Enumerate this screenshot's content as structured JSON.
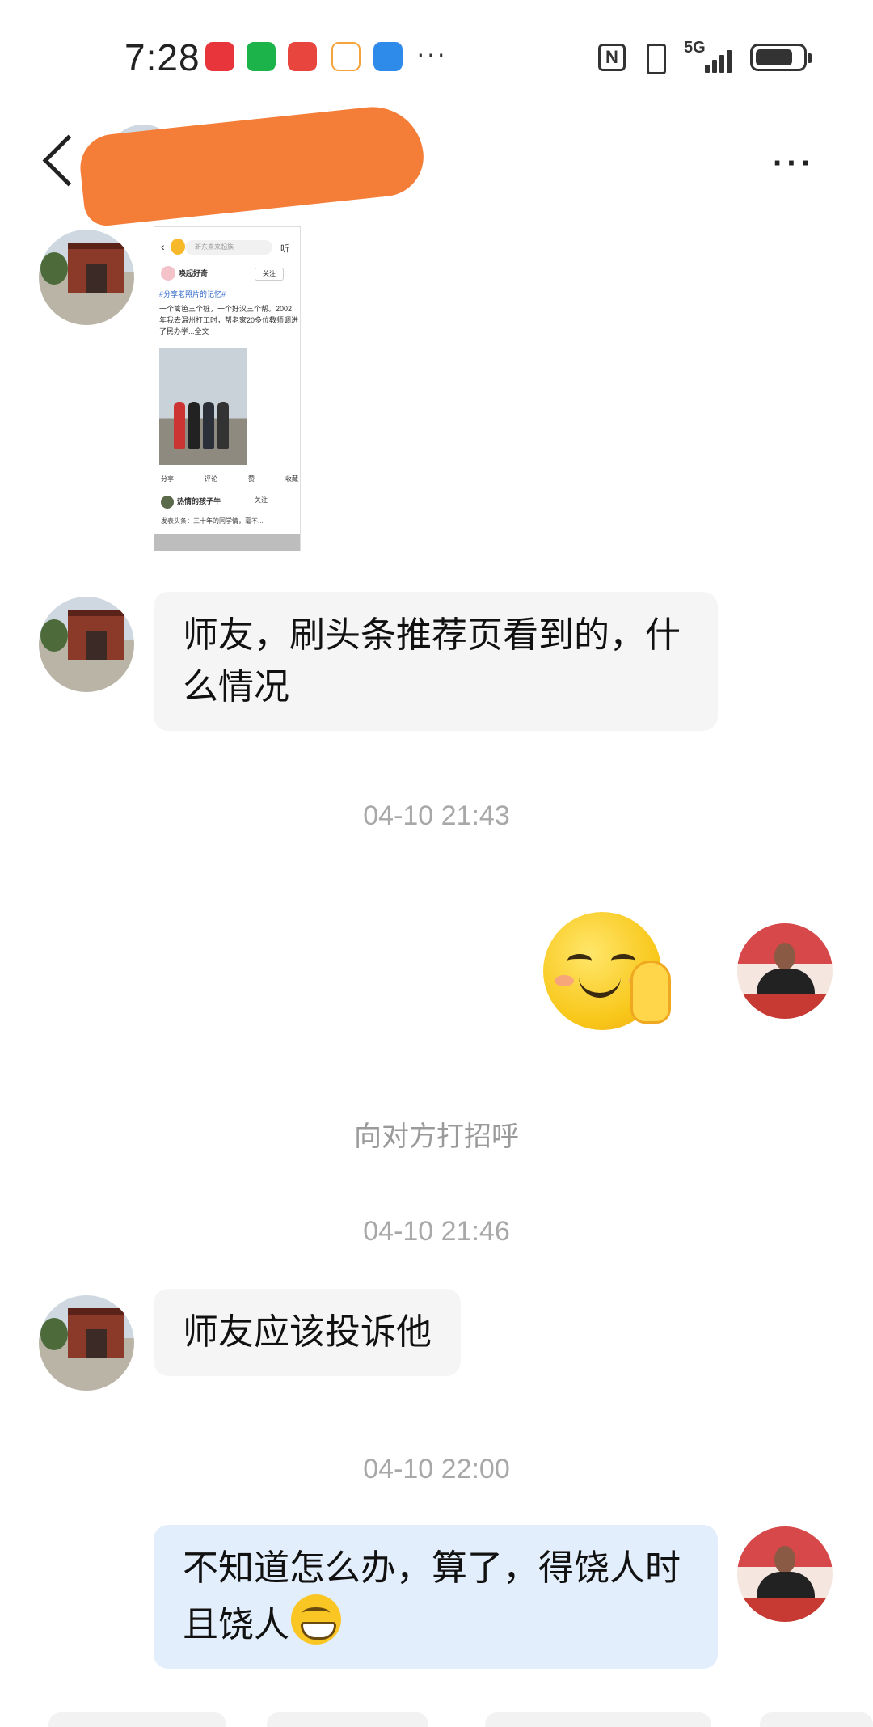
{
  "status_bar": {
    "time": "7:28",
    "network": "5G",
    "battery_level": 0.8,
    "app_icons": [
      "book-app-icon",
      "wechat-icon",
      "huawei-store-icon",
      "mascot-app-icon",
      "weather-icon"
    ]
  },
  "header": {
    "more_label": "···"
  },
  "shared_post": {
    "search_placeholder": "新东来来起族",
    "listen_label": "听",
    "author": "唤起好奇",
    "follow_label": "关注",
    "tag": "#分享老照片的记忆#",
    "text": "一个篱笆三个桩，一个好汉三个帮。2002年我去温州打工时，帮老家20多位教师调进了民办学...全文",
    "actions": [
      "分享",
      "评论",
      "赞",
      "收藏"
    ],
    "comment_author": "热情的孩子牛",
    "comment_follow": "关注",
    "comment_text": "发表头条：三十年的同学情，毫不..."
  },
  "messages": [
    {
      "type": "text",
      "direction": "in",
      "text": "师友，刷头条推荐页看到的，什么情况"
    },
    {
      "type": "timestamp",
      "text": "04-10 21:43"
    },
    {
      "type": "sticker",
      "direction": "out",
      "name": "smile-wave-emoji"
    },
    {
      "type": "system",
      "text": "向对方打招呼"
    },
    {
      "type": "timestamp",
      "text": "04-10 21:46"
    },
    {
      "type": "text",
      "direction": "in",
      "text": "师友应该投诉他"
    },
    {
      "type": "timestamp",
      "text": "04-10 22:00"
    },
    {
      "type": "text",
      "direction": "out",
      "text": "不知道怎么办，算了，得饶人时且饶人",
      "trailing_emoji": "grin-emoji"
    }
  ],
  "colors": {
    "incoming_bubble": "#f5f5f5",
    "outgoing_bubble": "#e3eefc",
    "timestamp_text": "#a8a8a8",
    "redaction": "#f47d38"
  }
}
